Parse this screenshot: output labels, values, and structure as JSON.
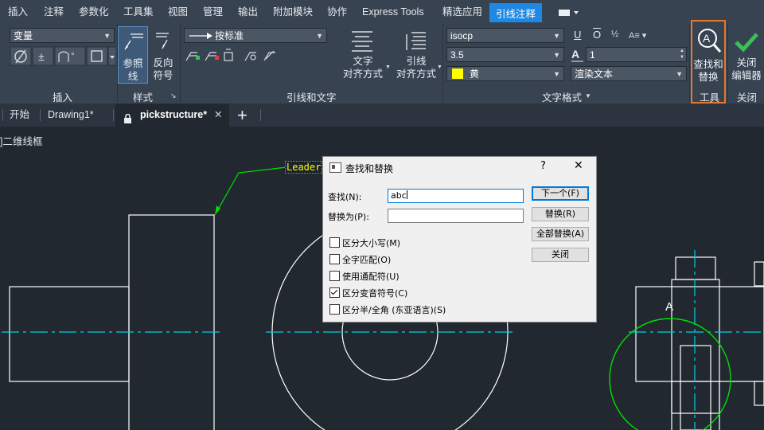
{
  "menu": {
    "items": [
      "插入",
      "注释",
      "参数化",
      "工具集",
      "视图",
      "管理",
      "输出",
      "附加模块",
      "协作",
      "Express Tools",
      "精选应用",
      "引线注释"
    ],
    "active_index": 11
  },
  "ribbon": {
    "insert_group": {
      "layer_dropdown": "变量",
      "label": "插入"
    },
    "style_group": {
      "reference_line": "参照\n线",
      "reverse_symbol": "反向\n符号",
      "label": "样式"
    },
    "leader_group": {
      "arrow_dropdown": "按标准",
      "text_align": "文字\n对齐方式",
      "leader_align": "引线\n对齐方式",
      "label": "引线和文字"
    },
    "text_format_group": {
      "font": "isocp",
      "height": "3.5",
      "color": "黄",
      "width_factor": "1",
      "render": "渲染文本",
      "u": "U",
      "o": "O",
      "label": "文字格式"
    },
    "tools_group": {
      "find_replace": "查找和\n替换",
      "label": "工具"
    },
    "close_group": {
      "close_editor": "关闭\n编辑器",
      "label": "关闭"
    }
  },
  "tabs": {
    "items": [
      "开始",
      "Drawing1*",
      "pickstructure*"
    ],
    "active_index": 2,
    "add": "+"
  },
  "canvas": {
    "viewport_label": "]二维线框",
    "leader_text": "Leader",
    "label_a": "A"
  },
  "dialog": {
    "title": "查找和替换",
    "help": "?",
    "close": "✕",
    "find_label": "查找(N):",
    "find_value": "abc",
    "replace_label": "替换为(P):",
    "replace_value": "",
    "buttons": {
      "next": "下一个(F)",
      "replace": "替换(R)",
      "replace_all": "全部替换(A)",
      "close": "关闭"
    },
    "options": [
      {
        "label": "区分大小写(M)",
        "checked": false
      },
      {
        "label": "全字匹配(O)",
        "checked": false
      },
      {
        "label": "使用通配符(U)",
        "checked": false
      },
      {
        "label": "区分变音符号(C)",
        "checked": true
      },
      {
        "label": "区分半/全角 (东亚语言)(S)",
        "checked": false
      }
    ]
  },
  "colors": {
    "accent": "#1e88e5",
    "highlight_border": "#e8772e",
    "check_green": "#3bbf5a",
    "canvas_bg": "#212830",
    "centerline": "#00d0e0",
    "leader_green": "#00e000",
    "text_color_swatch": "#ffff00"
  }
}
